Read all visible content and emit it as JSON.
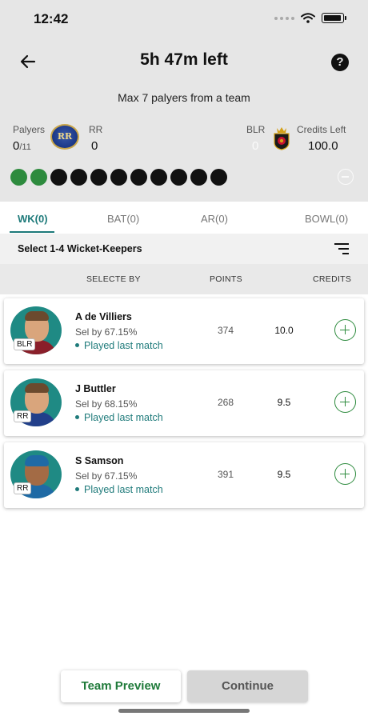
{
  "status_bar": {
    "time": "12:42"
  },
  "header": {
    "title": "5h 47m left",
    "help_label": "?",
    "subtitle": "Max 7 palyers from a team"
  },
  "summary": {
    "players_label": "Palyers",
    "players_count": "0",
    "players_max": "/11",
    "team_left_name": "RR",
    "team_left_count": "0",
    "team_left_logo_text": "RR",
    "team_right_name": "BLR",
    "team_right_count": "0",
    "credits_label": "Credits Left",
    "credits_value": "100.0",
    "selection_dots": 11,
    "selection_filled": 2,
    "filled_color": "#2e8b3e"
  },
  "tabs": [
    {
      "label": "WK(0)",
      "active": true
    },
    {
      "label": "BAT(0)",
      "active": false
    },
    {
      "label": "AR(0)",
      "active": false
    },
    {
      "label": "BOWL(0)",
      "active": false
    }
  ],
  "select_bar": {
    "text": "Select 1-4 Wicket-Keepers",
    "filter_icon": "sort-lines-icon"
  },
  "columns": {
    "selected_by": "SELECTE BY",
    "points": "POINTS",
    "credits": "CREDITS"
  },
  "players": [
    {
      "name": "A de Villiers",
      "team": "BLR",
      "sel": "Sel by 67.15%",
      "played": "Played last match",
      "points": "374",
      "credits": "10.0"
    },
    {
      "name": "J Buttler",
      "team": "RR",
      "sel": "Sel by 68.15%",
      "played": "Played last match",
      "points": "268",
      "credits": "9.5"
    },
    {
      "name": "S Samson",
      "team": "RR",
      "sel": "Sel by 67.15%",
      "played": "Played last match",
      "points": "391",
      "credits": "9.5"
    }
  ],
  "footer": {
    "preview_label": "Team Preview",
    "continue_label": "Continue"
  },
  "colors": {
    "accent_teal": "#1e7a7a",
    "accent_green": "#2e8b3e"
  }
}
